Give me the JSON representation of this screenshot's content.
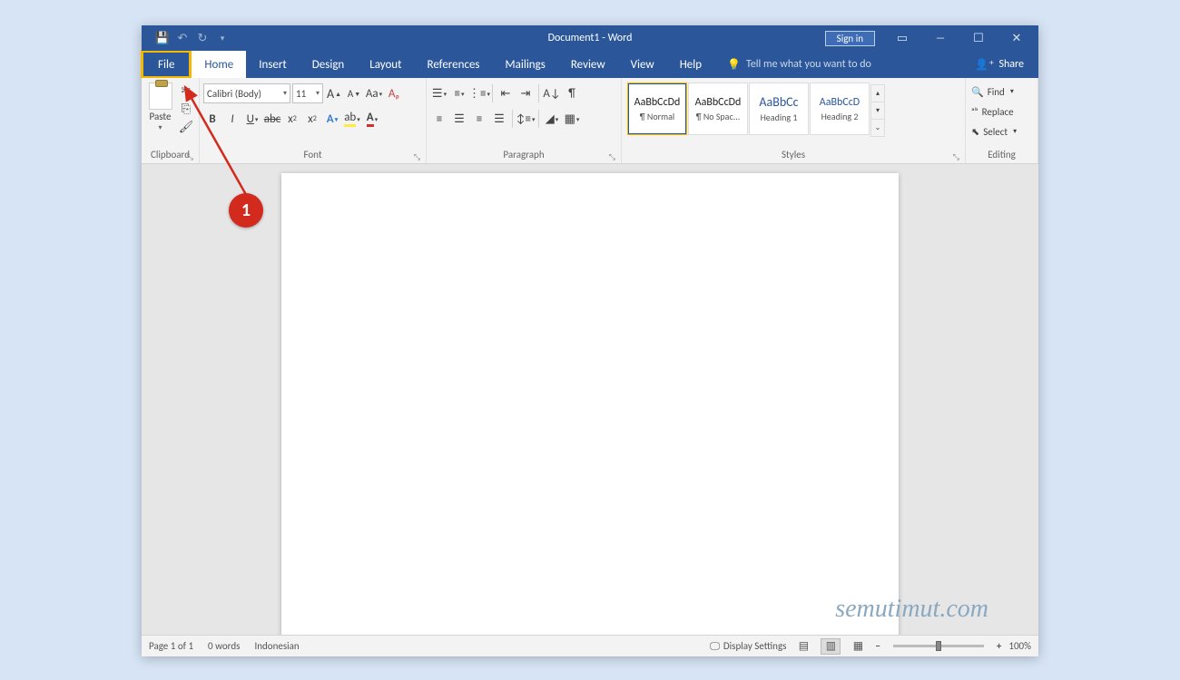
{
  "titlebar": {
    "title": "Document1  -  Word",
    "signin": "Sign in"
  },
  "tabs": {
    "file": "File",
    "home": "Home",
    "insert": "Insert",
    "design": "Design",
    "layout": "Layout",
    "references": "References",
    "mailings": "Mailings",
    "review": "Review",
    "view": "View",
    "help": "Help",
    "tellme": "Tell me what you want to do",
    "share": "Share"
  },
  "ribbon": {
    "clipboard": {
      "label": "Clipboard",
      "paste": "Paste"
    },
    "font": {
      "label": "Font",
      "fontname": "Calibri (Body)",
      "fontsize": "11"
    },
    "paragraph": {
      "label": "Paragraph"
    },
    "styles": {
      "label": "Styles",
      "items": [
        {
          "preview": "AaBbCcDd",
          "name": "¶ Normal"
        },
        {
          "preview": "AaBbCcDd",
          "name": "¶ No Spac..."
        },
        {
          "preview": "AaBbCc",
          "name": "Heading 1"
        },
        {
          "preview": "AaBbCcD",
          "name": "Heading 2"
        }
      ]
    },
    "editing": {
      "label": "Editing",
      "find": "Find",
      "replace": "Replace",
      "select": "Select"
    }
  },
  "status": {
    "page": "Page 1 of 1",
    "words": "0 words",
    "language": "Indonesian",
    "display": "Display Settings",
    "zoom": "100%"
  },
  "watermark": "semutimut.com",
  "annotation": {
    "badge": "1"
  }
}
